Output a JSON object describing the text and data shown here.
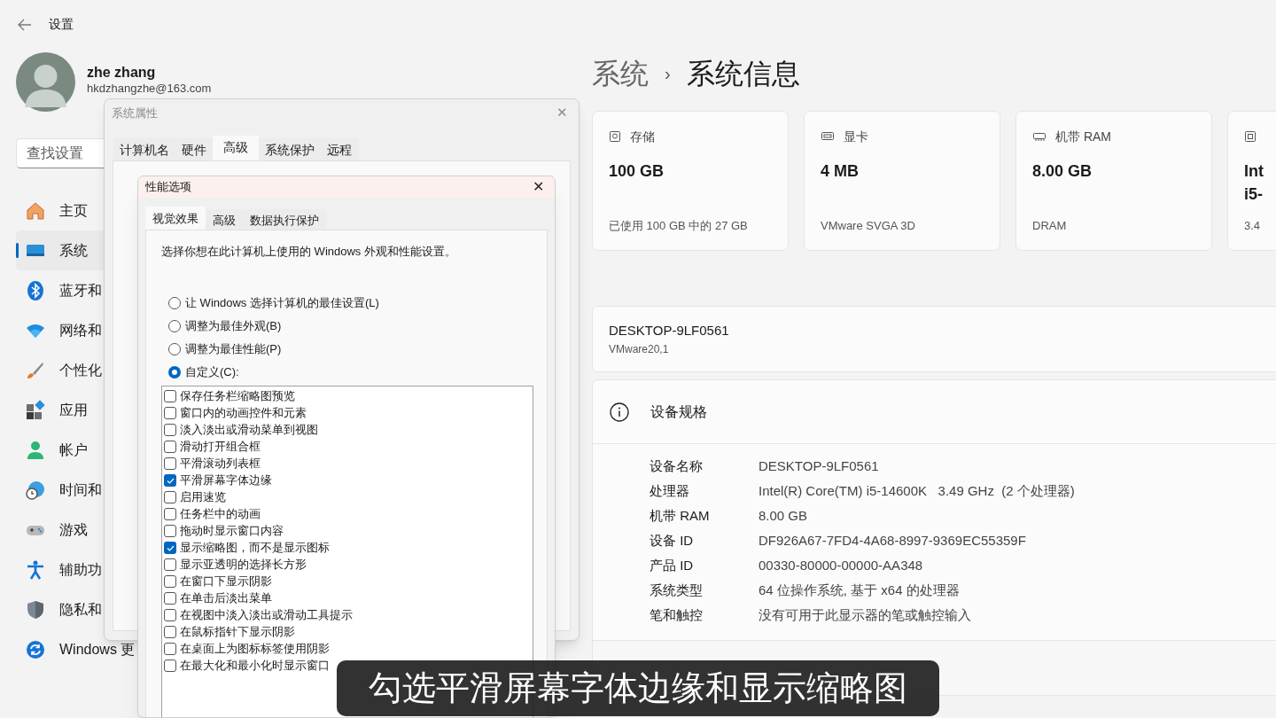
{
  "header": {
    "title": "设置"
  },
  "user": {
    "name": "zhe zhang",
    "email": "hkdzhangzhe@163.com"
  },
  "search": {
    "placeholder": "查找设置"
  },
  "nav": [
    {
      "label": "主页",
      "selected": false
    },
    {
      "label": "系统",
      "selected": true
    },
    {
      "label": "蓝牙和",
      "selected": false
    },
    {
      "label": "网络和",
      "selected": false
    },
    {
      "label": "个性化",
      "selected": false
    },
    {
      "label": "应用",
      "selected": false
    },
    {
      "label": "帐户",
      "selected": false
    },
    {
      "label": "时间和",
      "selected": false
    },
    {
      "label": "游戏",
      "selected": false
    },
    {
      "label": "辅助功",
      "selected": false
    },
    {
      "label": "隐私和",
      "selected": false
    },
    {
      "label": "Windows 更",
      "selected": false
    }
  ],
  "breadcrumb": [
    "系统",
    "›",
    "系统信息"
  ],
  "cards": [
    {
      "title": "存储",
      "value_lines": [
        "100 GB"
      ],
      "sub": "已使用 100 GB 中的 27 GB"
    },
    {
      "title": "显卡",
      "value_lines": [
        "4 MB"
      ],
      "sub": "VMware SVGA 3D"
    },
    {
      "title": "机带 RAM",
      "value_lines": [
        "8.00 GB"
      ],
      "sub": "DRAM"
    },
    {
      "value_lines": [
        "Int",
        "i5-"
      ],
      "sub": "3.4"
    }
  ],
  "device": {
    "name": "DESKTOP-9LF0561",
    "model": "VMware20,1"
  },
  "specs": {
    "title": "设备规格",
    "rows": [
      {
        "label": "设备名称",
        "value": "DESKTOP-9LF0561"
      },
      {
        "label": "处理器",
        "value": "Intel(R) Core(TM) i5-14600K   3.49 GHz  (2 个处理器)"
      },
      {
        "label": "机带 RAM",
        "value": "8.00 GB"
      },
      {
        "label": "设备 ID",
        "value": "DF926A67-7FD4-4A68-8997-9369EC55359F"
      },
      {
        "label": "产品 ID",
        "value": "00330-80000-00000-AA348"
      },
      {
        "label": "系统类型",
        "value": "64 位操作系统, 基于 x64 的处理器"
      },
      {
        "label": "笔和触控",
        "value": "没有可用于此显示器的笔或触控输入"
      }
    ]
  },
  "system_properties": {
    "title": "系统属性",
    "close": "✕",
    "tabs": [
      {
        "label": "计算机名",
        "selected": false
      },
      {
        "label": "硬件",
        "selected": false
      },
      {
        "label": "高级",
        "selected": true
      },
      {
        "label": "系统保护",
        "selected": false
      },
      {
        "label": "远程",
        "selected": false
      }
    ]
  },
  "performance_options": {
    "title": "性能选项",
    "close": "✕",
    "tabs": [
      {
        "label": "视觉效果",
        "selected": true
      },
      {
        "label": "高级",
        "selected": false
      },
      {
        "label": "数据执行保护",
        "selected": false
      }
    ],
    "intro": "选择你想在此计算机上使用的 Windows 外观和性能设置。",
    "radios": [
      {
        "label": "让 Windows 选择计算机的最佳设置(L)",
        "selected": false
      },
      {
        "label": "调整为最佳外观(B)",
        "selected": false
      },
      {
        "label": "调整为最佳性能(P)",
        "selected": false
      },
      {
        "label": "自定义(C):",
        "selected": true
      }
    ],
    "options": [
      {
        "label": "保存任务栏缩略图预览",
        "checked": false
      },
      {
        "label": "窗口内的动画控件和元素",
        "checked": false
      },
      {
        "label": "淡入淡出或滑动菜单到视图",
        "checked": false
      },
      {
        "label": "滑动打开组合框",
        "checked": false
      },
      {
        "label": "平滑滚动列表框",
        "checked": false
      },
      {
        "label": "平滑屏幕字体边缘",
        "checked": true
      },
      {
        "label": "启用速览",
        "checked": false
      },
      {
        "label": "任务栏中的动画",
        "checked": false
      },
      {
        "label": "拖动时显示窗口内容",
        "checked": false
      },
      {
        "label": "显示缩略图，而不是显示图标",
        "checked": true
      },
      {
        "label": "显示亚透明的选择长方形",
        "checked": false
      },
      {
        "label": "在窗口下显示阴影",
        "checked": false
      },
      {
        "label": "在单击后淡出菜单",
        "checked": false
      },
      {
        "label": "在视图中淡入淡出或滑动工具提示",
        "checked": false
      },
      {
        "label": "在鼠标指针下显示阴影",
        "checked": false
      },
      {
        "label": "在桌面上为图标标签使用阴影",
        "checked": false
      },
      {
        "label": "在最大化和最小化时显示窗口",
        "checked": false
      }
    ]
  },
  "caption": "勾选平滑屏幕字体边缘和显示缩略图"
}
